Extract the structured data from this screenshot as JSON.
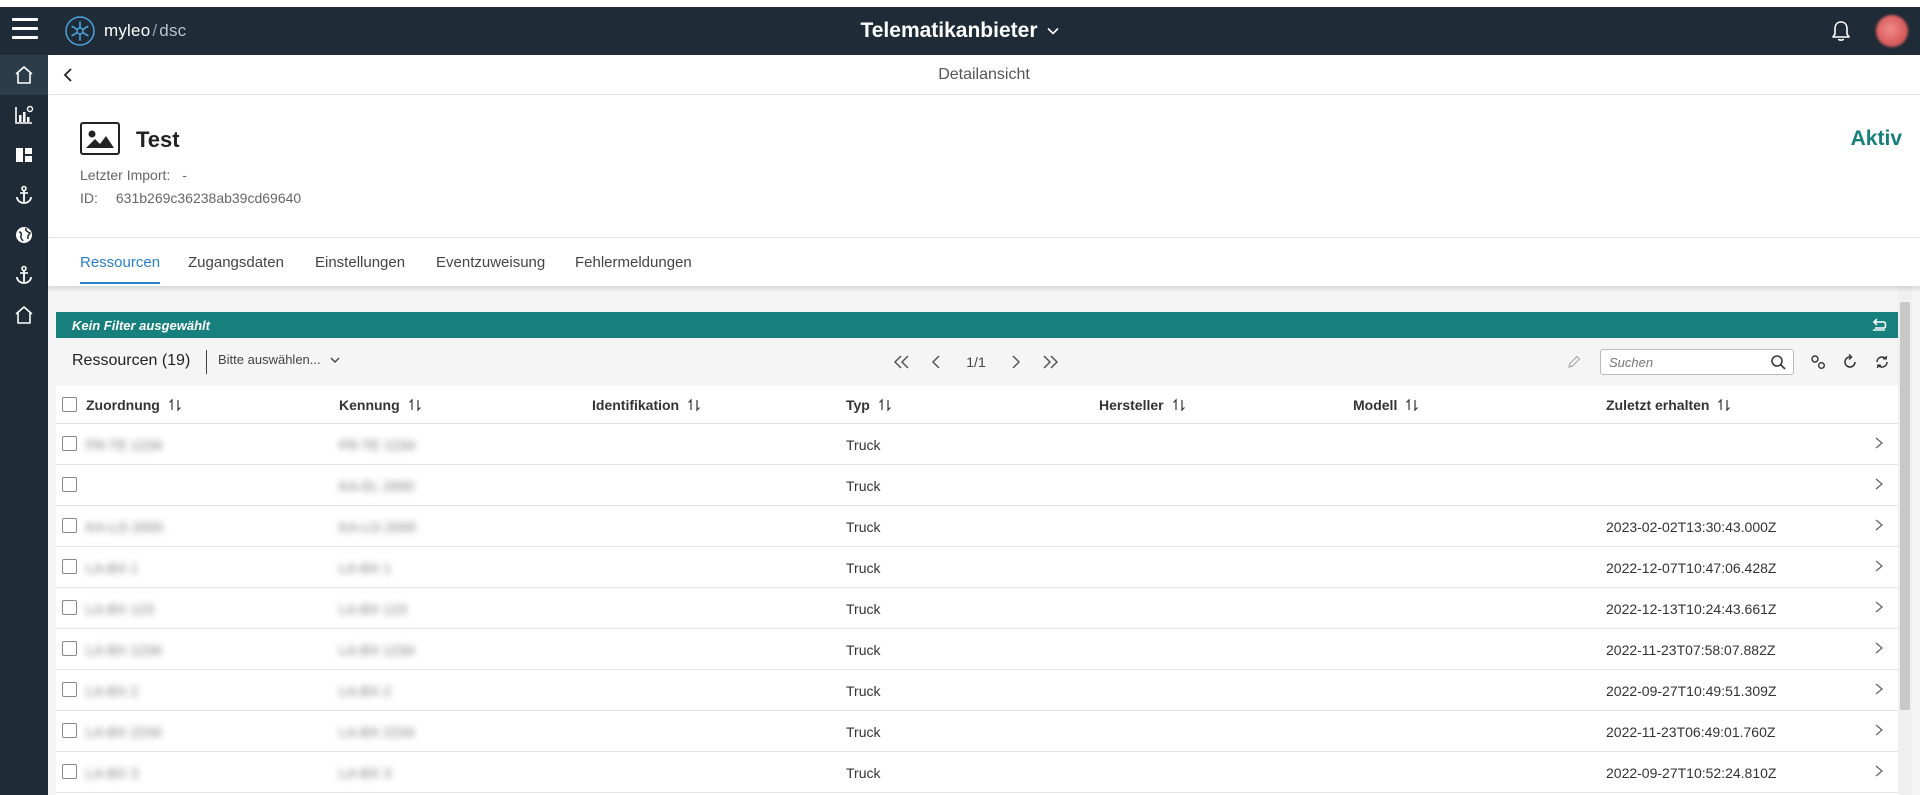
{
  "header": {
    "logo_brand": "myleo",
    "logo_sep": "/",
    "logo_product": "dsc",
    "title": "Telematikanbieter"
  },
  "sidebar": {
    "items": [
      {
        "icon": "home-icon"
      },
      {
        "icon": "chart-icon"
      },
      {
        "icon": "dashboard-icon"
      },
      {
        "icon": "anchor-icon"
      },
      {
        "icon": "globe-icon"
      },
      {
        "icon": "anchor-icon"
      },
      {
        "icon": "home-icon"
      }
    ]
  },
  "subheader": {
    "title": "Detailansicht"
  },
  "entity": {
    "name": "Test",
    "status": "Aktiv",
    "last_import_label": "Letzter Import:",
    "last_import_value": "-",
    "id_label": "ID:",
    "id_value": "631b269c36238ab39cd69640"
  },
  "tabs": [
    {
      "label": "Ressourcen",
      "active": true
    },
    {
      "label": "Zugangsdaten",
      "active": false
    },
    {
      "label": "Einstellungen",
      "active": false
    },
    {
      "label": "Eventzuweisung",
      "active": false
    },
    {
      "label": "Fehlermeldungen",
      "active": false
    }
  ],
  "filter": {
    "text": "Kein Filter ausgewählt"
  },
  "toolbar": {
    "resources_title": "Ressourcen (19)",
    "select_placeholder": "Bitte auswählen...",
    "page": "1/1",
    "search_placeholder": "Suchen"
  },
  "table": {
    "columns": [
      "Zuordnung",
      "Kennung",
      "Identifikation",
      "Typ",
      "Hersteller",
      "Modell",
      "Zuletzt erhalten"
    ],
    "rows": [
      {
        "zuordnung": "FR-TE 1234",
        "kennung": "FR-TE 1234",
        "identifikation": "",
        "typ": "Truck",
        "hersteller": "",
        "modell": "",
        "zuletzt": ""
      },
      {
        "zuordnung": "",
        "kennung": "KA-EL 2000",
        "identifikation": "",
        "typ": "Truck",
        "hersteller": "",
        "modell": "",
        "zuletzt": ""
      },
      {
        "zuordnung": "KA-LG 2000",
        "kennung": "KA-LG 2000",
        "identifikation": "",
        "typ": "Truck",
        "hersteller": "",
        "modell": "",
        "zuletzt": "2023-02-02T13:30:43.000Z"
      },
      {
        "zuordnung": "LA-BX 1",
        "kennung": "LA-BX 1",
        "identifikation": "",
        "typ": "Truck",
        "hersteller": "",
        "modell": "",
        "zuletzt": "2022-12-07T10:47:06.428Z"
      },
      {
        "zuordnung": "LA-BX 123",
        "kennung": "LA-BX 123",
        "identifikation": "",
        "typ": "Truck",
        "hersteller": "",
        "modell": "",
        "zuletzt": "2022-12-13T10:24:43.661Z"
      },
      {
        "zuordnung": "LA-BX 1234",
        "kennung": "LA-BX 1234",
        "identifikation": "",
        "typ": "Truck",
        "hersteller": "",
        "modell": "",
        "zuletzt": "2022-11-23T07:58:07.882Z"
      },
      {
        "zuordnung": "LA-BX 2",
        "kennung": "LA-BX 2",
        "identifikation": "",
        "typ": "Truck",
        "hersteller": "",
        "modell": "",
        "zuletzt": "2022-09-27T10:49:51.309Z"
      },
      {
        "zuordnung": "LA-BX 2234",
        "kennung": "LA-BX 2234",
        "identifikation": "",
        "typ": "Truck",
        "hersteller": "",
        "modell": "",
        "zuletzt": "2022-11-23T06:49:01.760Z"
      },
      {
        "zuordnung": "LA-BX 3",
        "kennung": "LA-BX 3",
        "identifikation": "",
        "typ": "Truck",
        "hersteller": "",
        "modell": "",
        "zuletzt": "2022-09-27T10:52:24.810Z"
      }
    ]
  },
  "colors": {
    "header_bg": "#1f2b36",
    "accent": "#17807c",
    "tab_active": "#2a7fc7"
  }
}
